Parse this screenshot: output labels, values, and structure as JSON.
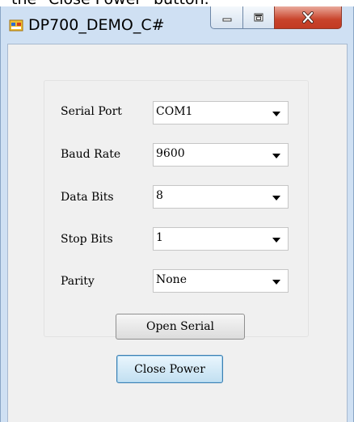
{
  "caption_fragment": "the \"Close Power\" button.",
  "window": {
    "title": "DP700_DEMO_C#",
    "controls": {
      "minimize_icon": "minimize-icon",
      "maximize_icon": "maximize-icon",
      "close_icon": "close-icon"
    },
    "close_color": "#c8432b"
  },
  "settings": {
    "fields": [
      {
        "label": "Serial Port",
        "value": "COM1"
      },
      {
        "label": "Baud Rate",
        "value": "9600"
      },
      {
        "label": "Data Bits",
        "value": "8"
      },
      {
        "label": "Stop Bits",
        "value": "1"
      },
      {
        "label": "Parity",
        "value": "None"
      }
    ],
    "open_button": "Open Serial"
  },
  "close_power_button": "Close Power"
}
